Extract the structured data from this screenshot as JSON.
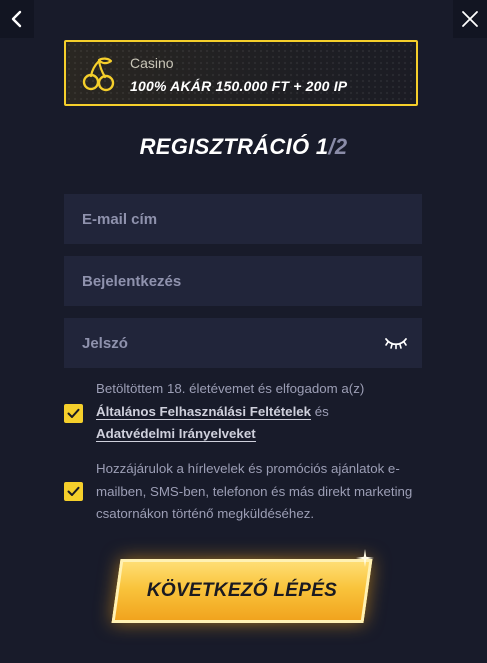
{
  "nav": {
    "back_icon": "chevron-left-icon",
    "close_icon": "close-icon"
  },
  "bonus": {
    "icon": "cherries-icon",
    "category": "Casino",
    "offer": "100% AKÁR 150.000 FT + 200 IP",
    "border_color": "#f5cf2b"
  },
  "title": {
    "text": "REGISZTRÁCIÓ",
    "current_step": "1",
    "separator": "/",
    "total_steps": "2"
  },
  "form": {
    "email_placeholder": "E-mail cím",
    "username_placeholder": "Bejelentkezés",
    "password_placeholder": "Jelszó",
    "password_toggle_icon": "eye-closed-icon"
  },
  "consents": {
    "terms": {
      "checked": true,
      "text_before": "Betöltöttem 18. életévemet és elfogadom a(z)",
      "link1": "Általános Felhasználási Feltételek",
      "text_mid": "és",
      "link2": "Adatvédelmi Irányelveket"
    },
    "marketing": {
      "checked": true,
      "text": "Hozzájárulok a hírlevelek és promóciós ajánlatok e-mailben, SMS-ben, telefonon és más direkt marketing csatornákon történő megküldéséhez."
    }
  },
  "cta": {
    "label": "KÖVETKEZŐ LÉPÉS"
  },
  "colors": {
    "background": "#181b2a",
    "field": "#21253a",
    "accent": "#f5cf2b"
  }
}
